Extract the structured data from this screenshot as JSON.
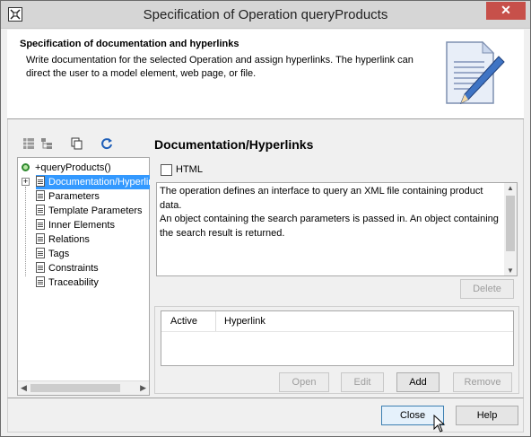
{
  "window": {
    "title": "Specification of Operation queryProducts",
    "close_glyph": "✕"
  },
  "header": {
    "title": "Specification of documentation and hyperlinks",
    "description": "Write documentation for the selected Operation and assign hyperlinks. The hyperlink can direct the user to a model element, web page, or file."
  },
  "toolbar": {
    "icons": [
      "table-view-icon",
      "tree-view-icon",
      "copy-icon",
      "refresh-icon"
    ]
  },
  "tree": {
    "root": "+queryProducts()",
    "items": [
      {
        "label": "Documentation/Hyperlinks",
        "selected": true
      },
      {
        "label": "Parameters",
        "selected": false
      },
      {
        "label": "Template Parameters",
        "selected": false
      },
      {
        "label": "Inner Elements",
        "selected": false
      },
      {
        "label": "Relations",
        "selected": false
      },
      {
        "label": "Tags",
        "selected": false
      },
      {
        "label": "Constraints",
        "selected": false
      },
      {
        "label": "Traceability",
        "selected": false
      }
    ]
  },
  "main": {
    "section_title": "Documentation/Hyperlinks",
    "html_label": "HTML",
    "html_checked": false,
    "documentation": "The operation defines an interface to query an XML file containing product data.\nAn object containing the search parameters is passed in. An object containing the search result is returned.",
    "delete_label": "Delete",
    "table_headers": [
      "Active",
      "Hyperlink"
    ],
    "open_label": "Open",
    "edit_label": "Edit",
    "add_label": "Add",
    "remove_label": "Remove"
  },
  "footer": {
    "close_label": "Close",
    "help_label": "Help"
  },
  "colors": {
    "selection": "#3399ff",
    "close_button": "#c7504a"
  }
}
